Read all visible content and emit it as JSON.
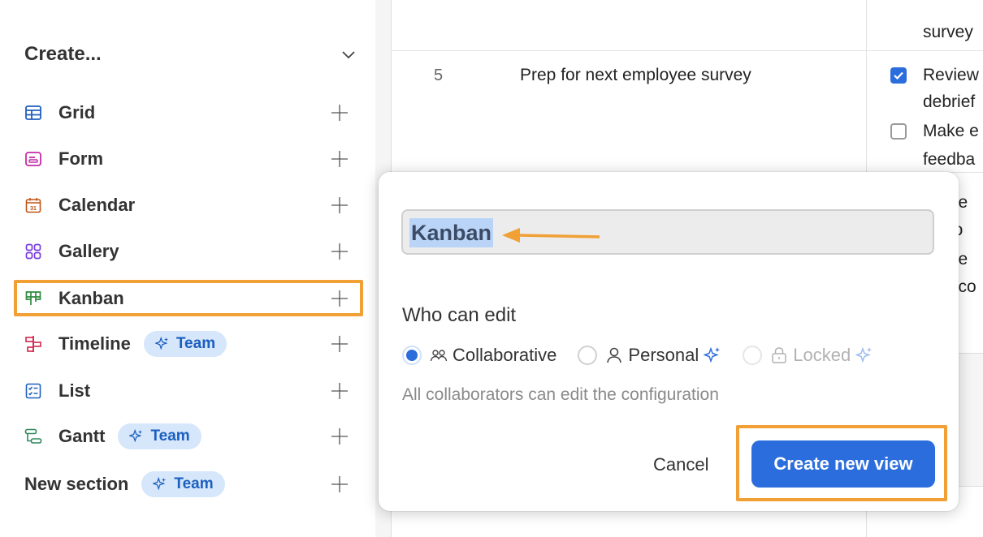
{
  "sidebar": {
    "create_title": "Create...",
    "items": [
      {
        "label": "Grid",
        "icon": "grid-icon",
        "color": "#1f5fbf"
      },
      {
        "label": "Form",
        "icon": "form-icon",
        "color": "#c42ba6"
      },
      {
        "label": "Calendar",
        "icon": "calendar-icon",
        "color": "#c05414"
      },
      {
        "label": "Gallery",
        "icon": "gallery-icon",
        "color": "#7a3be0"
      },
      {
        "label": "Kanban",
        "icon": "kanban-icon",
        "color": "#2f8a3e"
      },
      {
        "label": "Timeline",
        "icon": "timeline-icon",
        "color": "#d1274b",
        "badge": "Team"
      },
      {
        "label": "List",
        "icon": "list-icon",
        "color": "#1f5fbf"
      },
      {
        "label": "Gantt",
        "icon": "gantt-icon",
        "color": "#2f8a5e",
        "badge": "Team"
      },
      {
        "label": "New section",
        "icon": null,
        "badge": "Team"
      }
    ]
  },
  "table": {
    "row_number": "5",
    "row_title": "Prep for next employee survey",
    "cells": [
      "survey",
      "Review",
      "debrief",
      "Make e",
      "feedba",
      "ft e",
      "po",
      "o e",
      "o co"
    ]
  },
  "dialog": {
    "name_value": "Kanban",
    "who_can_edit_title": "Who can edit",
    "options": [
      {
        "label": "Collaborative",
        "selected": true,
        "icon": "collaborators-icon"
      },
      {
        "label": "Personal",
        "selected": false,
        "icon": "person-icon",
        "sparkle": true
      },
      {
        "label": "Locked",
        "selected": false,
        "icon": "lock-icon",
        "sparkle": true,
        "disabled": true
      }
    ],
    "helper_text": "All collaborators can edit the configuration",
    "cancel_label": "Cancel",
    "create_label": "Create new view"
  },
  "colors": {
    "accent": "#2b6ddc",
    "annotation": "#f0a035",
    "badge_bg": "#d6e6fb"
  }
}
